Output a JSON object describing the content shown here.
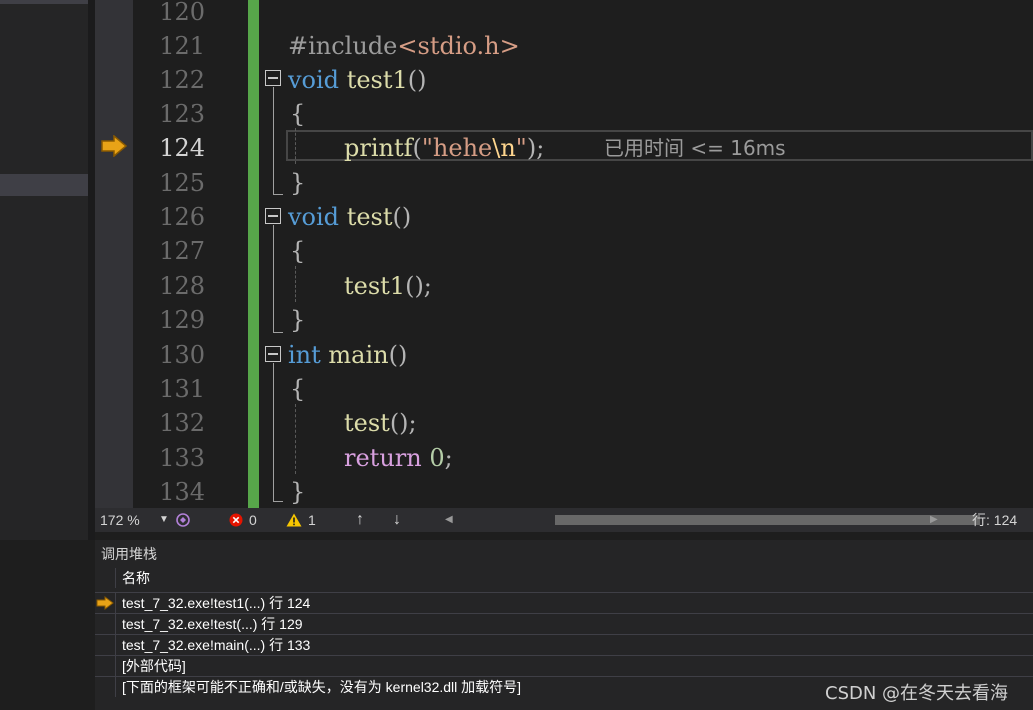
{
  "editor": {
    "line_numbers": [
      "120",
      "121",
      "122",
      "123",
      "124",
      "125",
      "126",
      "127",
      "128",
      "129",
      "130",
      "131",
      "132",
      "133",
      "134"
    ],
    "current_line": "124",
    "lines": {
      "l121": {
        "directive": "#include",
        "header": "<stdio.h>"
      },
      "l122": {
        "kw": "void",
        "fn": "test1",
        "rest": "()"
      },
      "l123": {
        "brace": "{"
      },
      "l124": {
        "fn": "printf",
        "p1": "(",
        "s1": "\"hehe",
        "esc": "\\n",
        "s2": "\"",
        "p2": ");"
      },
      "l125": {
        "brace": "}"
      },
      "l126": {
        "kw": "void",
        "fn": "test",
        "rest": "()"
      },
      "l127": {
        "brace": "{"
      },
      "l128": {
        "fn": "test1",
        "rest": "();"
      },
      "l129": {
        "brace": "}"
      },
      "l130": {
        "kw": "int",
        "fn": "main",
        "rest": "()"
      },
      "l131": {
        "brace": "{"
      },
      "l132": {
        "fn": "test",
        "rest": "();"
      },
      "l133": {
        "kw": "return",
        "num": "0",
        "rest": ";"
      },
      "l134": {
        "brace": "}"
      }
    },
    "elapsed_hint": "已用时间 <= 16ms"
  },
  "statusbar": {
    "zoom": "172 %",
    "errors": "0",
    "warnings": "1",
    "line_indicator": "行: 124"
  },
  "callstack": {
    "title": "调用堆栈",
    "column_header": "名称",
    "rows": [
      "test_7_32.exe!test1(...) 行 124",
      "test_7_32.exe!test(...) 行 129",
      "test_7_32.exe!main(...) 行 133",
      "[外部代码]",
      "[下面的框架可能不正确和/或缺失，没有为 kernel32.dll 加载符号]"
    ]
  },
  "watermark": "CSDN @在冬天去看海",
  "colors": {
    "keyword": "#569cd6",
    "function": "#dcdcaa",
    "string": "#d69d85",
    "change_bar": "#57a64a",
    "arrow": "#e8a317"
  },
  "icons": [
    "current-statement-arrow-icon",
    "collapse-icon",
    "error-icon",
    "warning-icon",
    "up-arrow-icon",
    "down-arrow-icon",
    "intellicode-icon"
  ]
}
